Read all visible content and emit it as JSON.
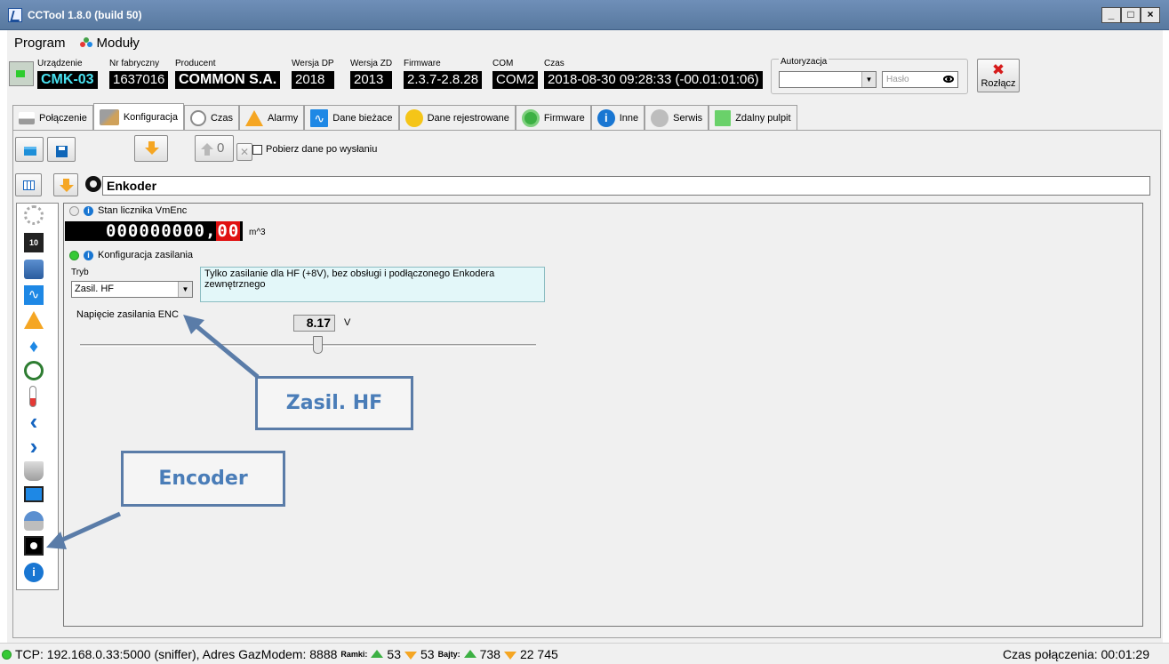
{
  "window": {
    "title": "CCTool 1.8.0 (build 50)",
    "minimize": "_",
    "maximize": "□",
    "close": "×"
  },
  "menu": {
    "program": "Program",
    "modules": "Moduły"
  },
  "device": {
    "fields": [
      {
        "label": "Urządzenie",
        "value": "CMK-03"
      },
      {
        "label": "Nr fabryczny",
        "value": "1637016"
      },
      {
        "label": "Producent",
        "value": "COMMON S.A."
      },
      {
        "label": "Wersja DP",
        "value": "2018"
      },
      {
        "label": "Wersja ZD",
        "value": "2013"
      },
      {
        "label": "Firmware",
        "value": "2.3.7-2.8.28"
      },
      {
        "label": "COM",
        "value": "COM2"
      },
      {
        "label": "Czas",
        "value": "2018-08-30  09:28:33 (-00.01:01:06)"
      }
    ],
    "auth_label": "Autoryzacja",
    "auth_user": "",
    "password_placeholder": "Hasło",
    "disconnect_label": "Rozłącz"
  },
  "tabs": [
    {
      "label": "Połączenie",
      "icon": "connection-icon"
    },
    {
      "label": "Konfiguracja",
      "icon": "tools-icon",
      "active": true
    },
    {
      "label": "Czas",
      "icon": "clock-icon"
    },
    {
      "label": "Alarmy",
      "icon": "warning-icon"
    },
    {
      "label": "Dane bieżace",
      "icon": "pulse-icon"
    },
    {
      "label": "Dane rejestrowane",
      "icon": "record-icon"
    },
    {
      "label": "Firmware",
      "icon": "refresh-icon"
    },
    {
      "label": "Inne",
      "icon": "info-icon"
    },
    {
      "label": "Serwis",
      "icon": "service-icon"
    },
    {
      "label": "Zdalny pulpit",
      "icon": "remote-icon"
    }
  ],
  "toolbar": {
    "upload_count": "0",
    "fetch_after_send_label": "Pobierz dane po wysłaniu",
    "fetch_after_send_checked": false
  },
  "section": {
    "title": "Enkoder"
  },
  "counter": {
    "header": "Stan licznika VmEnc",
    "integer": "000000000,",
    "decimal": "00",
    "unit": "m^3"
  },
  "power": {
    "header": "Konfiguracja zasilania",
    "mode_label": "Tryb",
    "mode_value": "Zasil. HF",
    "description": "Tylko zasilanie dla HF (+8V), bez obsługi i podłączonego Enkodera zewnętrznego",
    "voltage_label": "Napięcie zasilania ENC",
    "voltage_value": "8.17",
    "voltage_unit": "V",
    "slider_fraction": 0.52
  },
  "callouts": {
    "zasil": "Zasil. HF",
    "encoder": "Encoder"
  },
  "status": {
    "connection": "TCP: 192.168.0.33:5000 (sniffer), Adres GazModem: 8888",
    "frames_label": "Ramki:",
    "frames_up": "53",
    "frames_down": "53",
    "bytes_label": "Bajty:",
    "bytes_up": "738",
    "bytes_down": "22 745",
    "connection_time": "Czas połączenia: 00:01:29"
  },
  "colors": {
    "accent": "#5a7ca8",
    "callout_text": "#4a7db8",
    "counter_decimal": "#e01010",
    "status_ok": "#35c935"
  }
}
